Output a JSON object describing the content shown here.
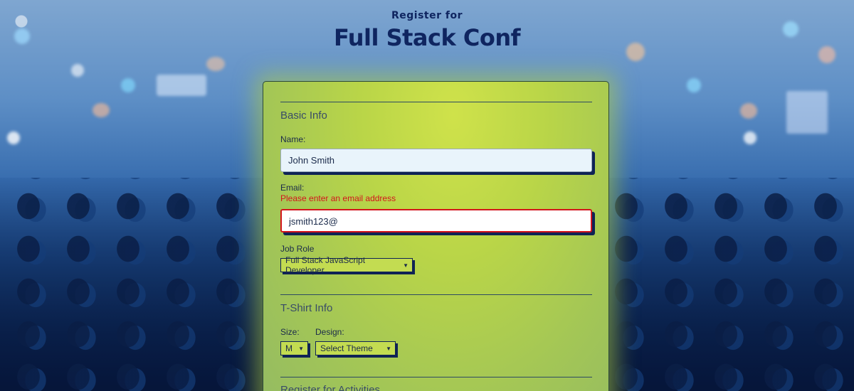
{
  "header": {
    "pre_title": "Register for",
    "title": "Full Stack Conf"
  },
  "form": {
    "basic_info": {
      "legend": "Basic Info",
      "name_label": "Name:",
      "name_value": "John Smith",
      "email_label": "Email:",
      "email_error": "Please enter an email address",
      "email_value": "jsmith123@",
      "job_role_label": "Job Role",
      "job_role_selected": "Full Stack JavaScript Developer"
    },
    "tshirt_info": {
      "legend": "T-Shirt Info",
      "size_label": "Size:",
      "size_selected": "M",
      "design_label": "Design:",
      "design_selected": "Select Theme"
    },
    "activities": {
      "legend": "Register for Activities"
    }
  },
  "colors": {
    "title": "#0f2560",
    "error": "#d3151c",
    "card": "#bcd64a",
    "input_shadow": "#0f2355"
  }
}
